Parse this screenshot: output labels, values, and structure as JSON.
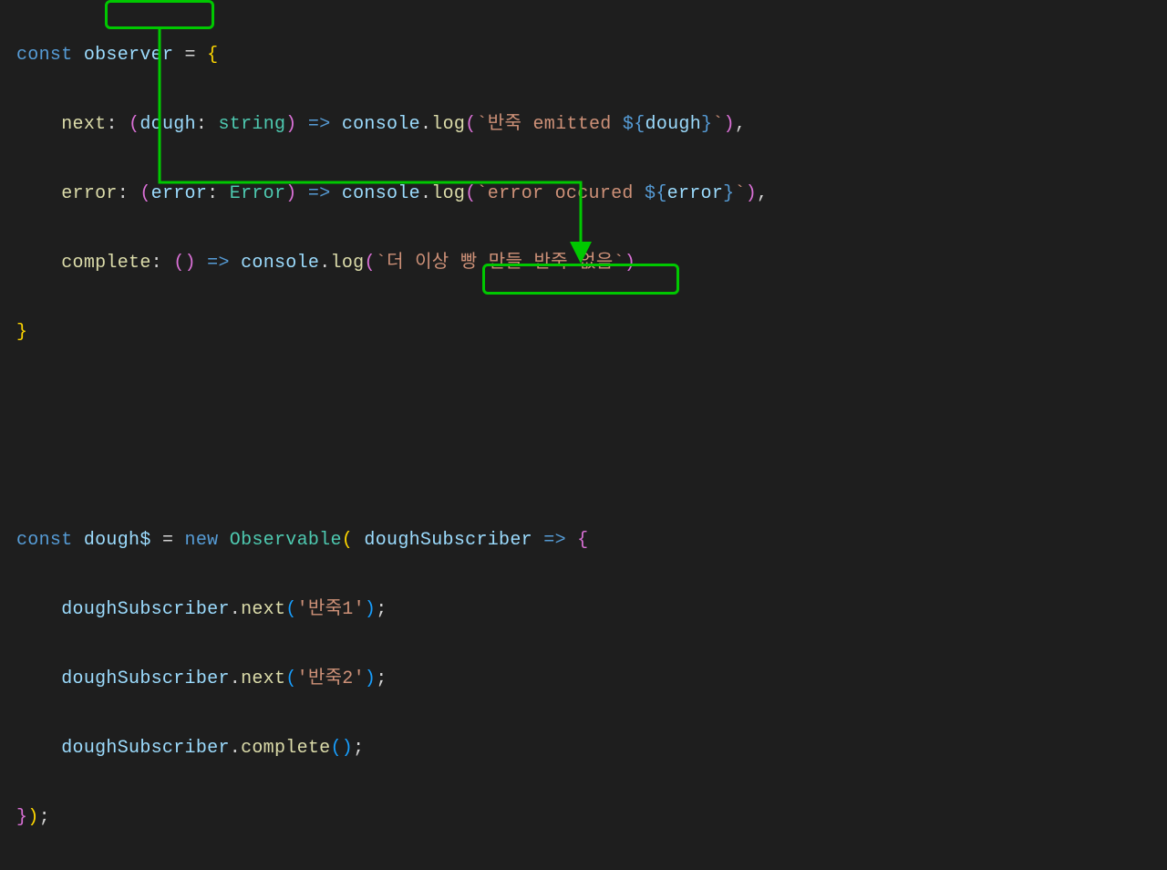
{
  "colors": {
    "background": "#1e1e1e",
    "highlight_border": "#00c800",
    "keyword": "#569cd6",
    "variable": "#9cdcfe",
    "function": "#dcdcaa",
    "type": "#4ec9b0",
    "string": "#ce9178",
    "brace_yellow": "#ffd700",
    "brace_purple": "#da70d6",
    "brace_blue": "#179fff"
  },
  "highlight_boxes": [
    {
      "target": "observer",
      "line": 1
    },
    {
      "target": "doughSubscriber",
      "line": 8
    }
  ],
  "arrow": {
    "from": "observer-box",
    "to": "doughSubscriber-box"
  },
  "code": {
    "block1": {
      "l1": {
        "kw": "const",
        "var": "observer",
        "eq": " = ",
        "brace": "{"
      },
      "l2": {
        "indent": "    ",
        "prop": "next",
        "colon": ": ",
        "lp": "(",
        "param": "dough",
        "pcolon": ": ",
        "ptype": "string",
        "rp": ")",
        "arrow": " => ",
        "obj": "console",
        "dot": ".",
        "method": "log",
        "call_l": "(",
        "tmpl_open": "`",
        "tmpl_text1": "반죽 emitted ",
        "interp_open": "${",
        "interp_var": "dough",
        "interp_close": "}",
        "tmpl_close": "`",
        "call_r": ")",
        "comma": ","
      },
      "l3": {
        "indent": "    ",
        "prop": "error",
        "colon": ": ",
        "lp": "(",
        "param": "error",
        "pcolon": ": ",
        "ptype": "Error",
        "rp": ")",
        "arrow": " => ",
        "obj": "console",
        "dot": ".",
        "method": "log",
        "call_l": "(",
        "tmpl_open": "`",
        "tmpl_text1": "error occured ",
        "interp_open": "${",
        "interp_var": "error",
        "interp_close": "}",
        "tmpl_close": "`",
        "call_r": ")",
        "comma": ","
      },
      "l4": {
        "indent": "    ",
        "prop": "complete",
        "colon": ": ",
        "lp": "(",
        "rp": ")",
        "arrow": " => ",
        "obj": "console",
        "dot": ".",
        "method": "log",
        "call_l": "(",
        "tmpl_open": "`",
        "tmpl_text1": "더 이상 빵 만들 반죽 없음",
        "tmpl_close": "`",
        "call_r": ")"
      },
      "l5": {
        "brace": "}"
      }
    },
    "blank": " ",
    "block2": {
      "l1": {
        "kw": "const",
        "var": "dough$",
        "eq": " = ",
        "new": "new",
        "sp": " ",
        "cls": "Observable",
        "lp": "(",
        "sp2": " ",
        "param": "doughSubscriber",
        "sp3": " ",
        "arrow": "=> ",
        "brace": "{"
      },
      "l2": {
        "indent": "    ",
        "obj": "doughSubscriber",
        "dot": ".",
        "method": "next",
        "lp": "(",
        "str_q1": "'",
        "str": "반죽1",
        "str_q2": "'",
        "rp": ")",
        "semi": ";"
      },
      "l3": {
        "indent": "    ",
        "obj": "doughSubscriber",
        "dot": ".",
        "method": "next",
        "lp": "(",
        "str_q1": "'",
        "str": "반죽2",
        "str_q2": "'",
        "rp": ")",
        "semi": ";"
      },
      "l4": {
        "indent": "    ",
        "obj": "doughSubscriber",
        "dot": ".",
        "method": "complete",
        "lp": "(",
        "rp": ")",
        "semi": ";"
      },
      "l5": {
        "brace": "}",
        "rp": ")",
        "semi": ";"
      }
    }
  }
}
